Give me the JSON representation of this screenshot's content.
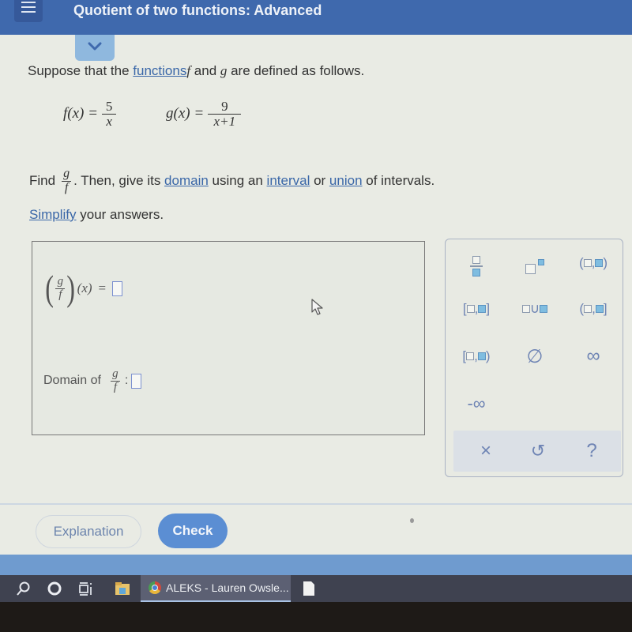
{
  "header": {
    "title": "Quotient of two functions: Advanced",
    "menu_icon": "hamburger-icon",
    "collapse_icon": "chevron-down-icon"
  },
  "prompt": {
    "intro_before": "Suppose that the ",
    "functions_link": "functions",
    "f": "f",
    "and": " and ",
    "g": "g",
    "intro_after": " are defined as follows."
  },
  "definitions": {
    "f": {
      "lhs": "f(x)",
      "eq": "=",
      "numerator": "5",
      "denominator": "x"
    },
    "g": {
      "lhs": "g(x)",
      "eq": "=",
      "numerator": "9",
      "denominator": "x+1"
    }
  },
  "instructions": {
    "find": "Find",
    "frac_num": "g",
    "frac_den": "f",
    "then": ". Then, give its ",
    "domain_link": "domain",
    "using": " using an ",
    "interval_link": "interval",
    "or": " or ",
    "union_link": "union",
    "of_intervals": " of intervals.",
    "simplify_link": "Simplify",
    "your_answers": " your answers."
  },
  "answer": {
    "quotient_num": "g",
    "quotient_den": "f",
    "quotient_arg": "(x)",
    "eq": "=",
    "quotient_value": "",
    "domain_label": "Domain of",
    "domain_num": "g",
    "domain_den": "f",
    "colon": ":",
    "domain_value": ""
  },
  "keypad": {
    "keys": [
      {
        "name": "fraction",
        "icon": "fraction-icon"
      },
      {
        "name": "exponent",
        "icon": "exponent-icon"
      },
      {
        "name": "open-interval",
        "icon": "open-interval-icon"
      },
      {
        "name": "closed-interval",
        "icon": "closed-interval-icon"
      },
      {
        "name": "union",
        "icon": "union-icon",
        "symbol": "∪"
      },
      {
        "name": "left-open-interval",
        "icon": "left-open-interval-icon"
      },
      {
        "name": "right-open-interval",
        "icon": "right-open-interval-icon"
      },
      {
        "name": "empty-set",
        "symbol": "∅"
      },
      {
        "name": "infinity",
        "symbol": "∞"
      },
      {
        "name": "negative-infinity",
        "symbol": "-∞"
      }
    ],
    "actions": {
      "clear": "×",
      "undo": "↺",
      "help": "?"
    },
    "accent": "#6e84b4",
    "filled_box": "#7fbde0"
  },
  "footer": {
    "explanation_label": "Explanation",
    "check_label": "Check",
    "check_color": "#5b8ed3"
  },
  "taskbar": {
    "app_label": "ALEKS - Lauren Owsle..."
  }
}
